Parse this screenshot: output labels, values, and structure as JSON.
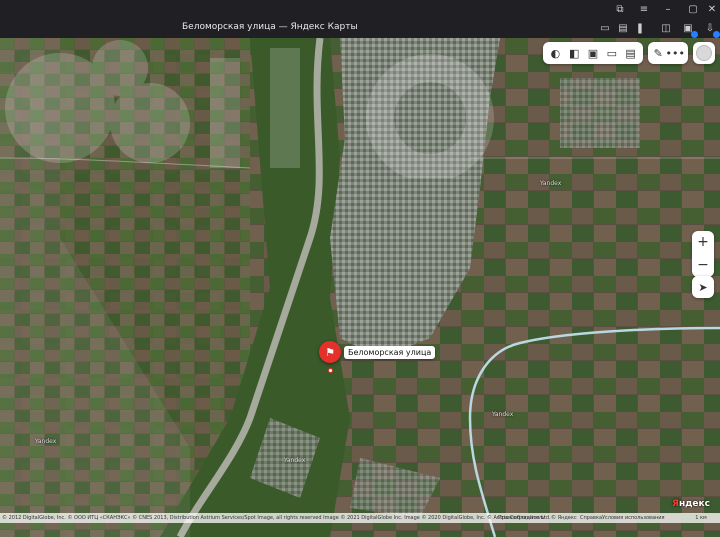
{
  "window": {
    "title": "Беломорская улица — Яндекс Карты"
  },
  "map": {
    "marker_label": "Беломорская улица",
    "towns": [
      "Yandex",
      "Yandex",
      "Yandex",
      "Yandex"
    ],
    "zoom_in": "+",
    "zoom_out": "−"
  },
  "attribution": {
    "copyright": "© 2012 DigitalGlobe, Inc. © ООО ИТЦ «СКАНЭКС» © CNES 2013, Distribution Astrium Services/Spot Image, all rights reserved Image © 2021 DigitalGlobe Inc. Image © 2020 DigitalGlobe, Inc. © Antrix Corporation Ltd.",
    "legal": "Правообладатели",
    "yandex": "© Яндекс",
    "help": "Справка",
    "terms": "Условия использования",
    "scale": "1 км"
  },
  "logo": {
    "ya": "Я",
    "rest": "ндекс"
  }
}
